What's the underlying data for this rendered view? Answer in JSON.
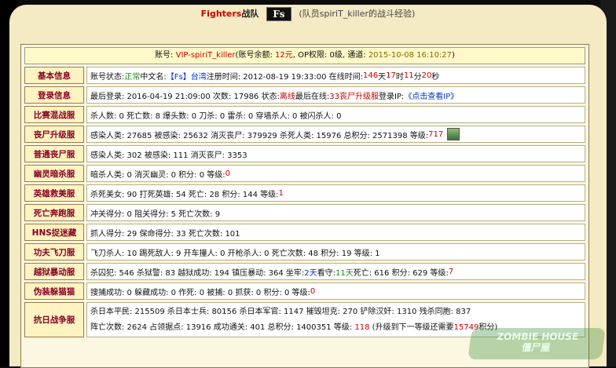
{
  "header": {
    "team_name": "Fighters",
    "team_word": "战队",
    "logo_text": "Fs",
    "note": "(队员spiriT_killer的战斗经验)"
  },
  "account": {
    "prefix": "账号: ",
    "name": "VIP-spiriT_killer",
    "balance_label": "(账号余额: ",
    "balance_value": "12元",
    "op_label": ", OP权限: 0级, 通道: ",
    "timestamp": "2015-10-08 16:10:27",
    "close": ")"
  },
  "rows": {
    "basic": {
      "label": "基本信息",
      "status_label": "账号状态: ",
      "status_value": "正常",
      "cn_name_label": " 中文名: ",
      "cn_name_value": "【Fs】台湾",
      "reg_label": " 注册时间: 2012-08-19 19:33:00 在线时间: ",
      "online_days": "146",
      "online_d": "天",
      "online_hours": "17",
      "online_h": "时",
      "online_mins": "11",
      "online_m": "分",
      "online_secs": "20",
      "online_s": "秒"
    },
    "login": {
      "label": "登录信息",
      "text1": "最后登录: 2016-04-19 21:09:00 次数: 17986 状态: ",
      "state": "离线",
      "text2": " 最后在线: ",
      "last_server": "33丧尸升级服",
      "text3": " 登录IP: ",
      "ip_link": "《点击查看IP》"
    },
    "melee": {
      "label": "比赛混战服",
      "text": "杀人数: 0 死亡数: 8 爆头数: 0 刀杀: 0 雷杀: 0 穿墙杀人: 0 被闪杀人: 0"
    },
    "zombie_up": {
      "label": "丧尸升级服",
      "text": "感染人类: 27685 被感染: 25632 消灭丧尸: 379929 杀死人类: 15976 总积分: 2571398 等级: ",
      "level": "717"
    },
    "zombie_normal": {
      "label": "普通丧尸服",
      "text": "感染人类: 302 被感染: 111 消灭丧尸: 3353"
    },
    "ghost": {
      "label": "幽灵暗杀服",
      "text": "暗杀人类: 0 消灭幽灵: 0 积分: 0 等级: ",
      "level": "0"
    },
    "hero": {
      "label": "英雄救美服",
      "text": "杀死美女: 90 打死英雄: 54 死亡: 28 积分: 144 等级: ",
      "level": "1"
    },
    "death_run": {
      "label": "死亡奔跑服",
      "text": "冲关得分: 0 阻关得分: 5 死亡次数: 9"
    },
    "hns": {
      "label": "HNS捉迷藏",
      "text": "抓人得分: 29 保命得分: 33 死亡次数: 101"
    },
    "kungfu": {
      "label": "功夫飞刀服",
      "text": "飞刀杀人: 10 踢死敌人: 9 开车撞人: 0 开枪杀人: 0 死亡次数: 48 积分: 19 等级: 1"
    },
    "jailbreak": {
      "label": "越狱暴动服",
      "text1": "杀囚犯: 546 杀狱警: 83 越狱成功: 194 镇压暴动: 364 坐牢: ",
      "jail_days": "2天",
      "text2": " 看守: ",
      "guard_days": "11天",
      "text3": " 死亡: 616 积分: 629 等级: ",
      "level": "7"
    },
    "disguise": {
      "label": "伪装躲猫猫",
      "text": "搜捕成功: 0 躲藏成功: 0 作死: 0 被捕: 0 抓获: 0 积分: 0 等级: ",
      "level": "0"
    },
    "war": {
      "label": "抗日战争服",
      "line1": "杀日本平民: 215509 杀日本士兵: 80156 杀日本军官: 1147 摧毁坦克: 270 铲除汉奸: 1310 残杀同胞: 837",
      "line2_a": "阵亡次数: 2624 占领据点: 13916 成功通关: 401 总积分: 1400351 等级: ",
      "level": "118",
      "line2_b": " (升级到下一等级还需要",
      "need": "15749",
      "line2_c": "积分)"
    }
  },
  "watermark": {
    "line1": "ZOMBIE HOUSE",
    "line2": "僵尸屋"
  }
}
